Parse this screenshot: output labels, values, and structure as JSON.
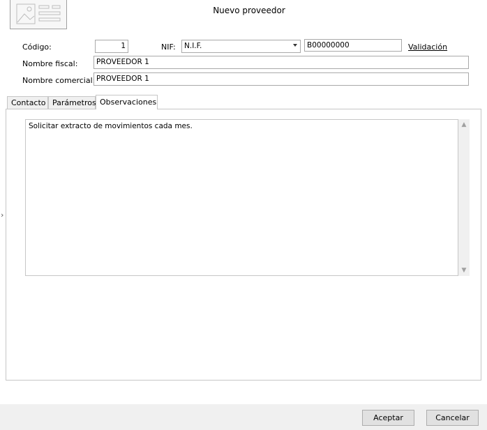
{
  "window": {
    "title": "Nuevo proveedor"
  },
  "form": {
    "codigo_label": "Código:",
    "codigo_value": "1",
    "nif_label": "NIF:",
    "nif_type": "N.I.F.",
    "nif_value": "B00000000",
    "validacion_label": "Validación",
    "nombre_fiscal_label": "Nombre fiscal:",
    "nombre_fiscal_value": "PROVEEDOR 1",
    "nombre_comercial_label": "Nombre comercial:",
    "nombre_comercial_value": "PROVEEDOR 1"
  },
  "tabs": [
    {
      "label": "Contacto"
    },
    {
      "label": "Parámetros"
    },
    {
      "label": "Observaciones",
      "active": true
    }
  ],
  "observaciones": {
    "text": "Solicitar extracto de movimientos cada mes."
  },
  "buttons": {
    "accept": "Aceptar",
    "cancel": "Cancelar"
  },
  "icons": {
    "header_image": "image-placeholder-icon",
    "dropdown": "chevron-down-icon",
    "scroll_up": "chevron-up-icon",
    "scroll_down": "chevron-down-icon",
    "side": "chevron-right-icon"
  }
}
